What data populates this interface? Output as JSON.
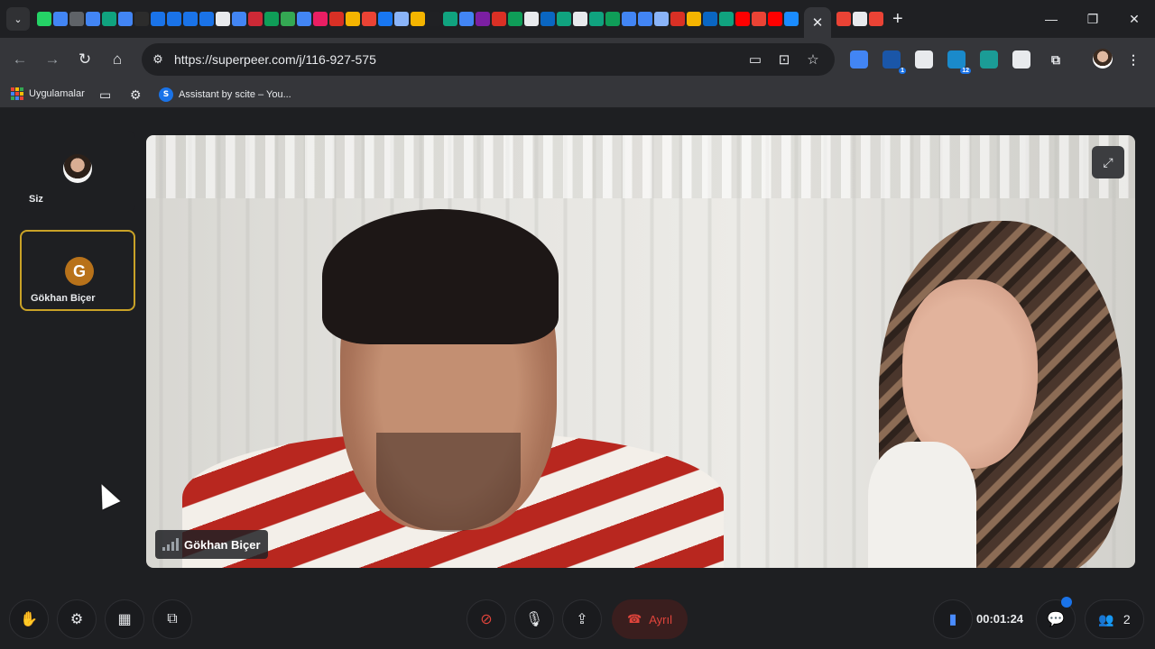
{
  "browser": {
    "tab_favicons": [
      "whatsapp",
      "chrome",
      "loader",
      "calendar-26",
      "chatgpt",
      "gt",
      "buffer",
      "s",
      "s",
      "s",
      "s",
      "notion",
      "docs",
      "zotero",
      "drive",
      "plus",
      "docs",
      "j",
      "a",
      "claude",
      "google",
      "facebook",
      "gemini",
      "claude",
      "openai",
      "chatgpt",
      "gt",
      "video",
      "m12",
      "triangle",
      "amazon",
      "linkedin",
      "chatgpt",
      "github",
      "chatgpt",
      "drive",
      "docs",
      "docs",
      "gemini",
      "news",
      "claude",
      "linkedin",
      "chatgpt",
      "youtube",
      "google",
      "youtube",
      "v",
      "google",
      "r",
      "google"
    ],
    "active_tab_close": "✕",
    "new_tab": "+",
    "tab_menu": "⌄",
    "window": {
      "minimize": "—",
      "restore": "❐",
      "close": "✕"
    },
    "url": "https://superpeer.com/j/116-927-575",
    "extensions": [
      {
        "name": "docs",
        "badge": "",
        "color": "#4285f4"
      },
      {
        "name": "f-ext",
        "badge": "1",
        "color": "#1a56a8"
      },
      {
        "name": "c-ext",
        "badge": "",
        "color": "#e8eaed"
      },
      {
        "name": "m-ext",
        "badge": "12",
        "color": "#1a8acb"
      },
      {
        "name": "teal-ext",
        "badge": "",
        "color": "#1b9c96"
      },
      {
        "name": "cloud-ext",
        "badge": "",
        "color": "#e8eaed"
      }
    ],
    "bookmarks": {
      "apps_label": "Uygulamalar",
      "scite_label": "Assistant by scite – You..."
    }
  },
  "meeting": {
    "participants": [
      {
        "name": "Siz",
        "avatar": "photo"
      },
      {
        "name": "Gökhan Biçer",
        "avatar": "G",
        "avatar_color": "#b8721a",
        "active": true
      }
    ],
    "main_video": {
      "speaker_name": "Gökhan Biçer"
    },
    "controls": {
      "leave_label": "Ayrıl",
      "timer": "00:01:24",
      "participant_count": "2"
    }
  }
}
